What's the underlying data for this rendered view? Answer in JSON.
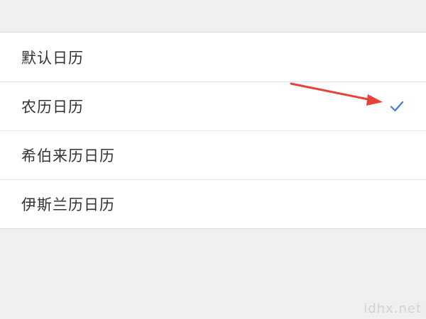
{
  "calendar_options": {
    "items": [
      {
        "label": "默认日历",
        "selected": false
      },
      {
        "label": "农历日历",
        "selected": true
      },
      {
        "label": "希伯来历日历",
        "selected": false
      },
      {
        "label": "伊斯兰历日历",
        "selected": false
      }
    ]
  },
  "icons": {
    "selected_marker": "checkmark-icon",
    "annotation": "red-arrow-icon"
  },
  "colors": {
    "accent": "#3d7fd6",
    "annotation_arrow": "#e8413a",
    "background": "#efeff1",
    "list_background": "#ffffff"
  },
  "watermark": {
    "text": "idhx.net"
  }
}
